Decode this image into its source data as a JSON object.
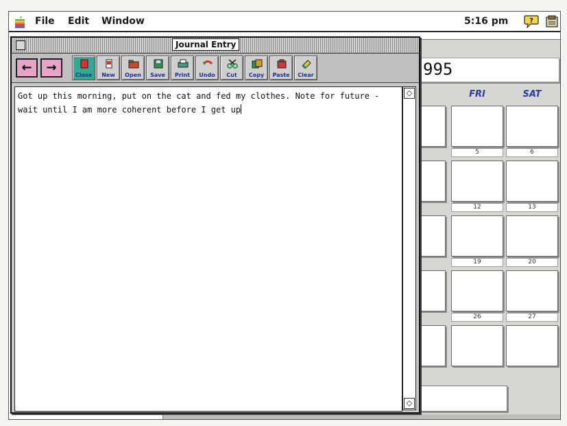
{
  "menubar": {
    "apple_icon": "apple-logo-icon",
    "items": [
      "File",
      "Edit",
      "Window"
    ],
    "clock": "5:16 pm",
    "help_icon": "balloon-help-icon",
    "app_icon": "application-menu-icon"
  },
  "journal_window": {
    "title": "Journal Entry",
    "nav": {
      "back": "←",
      "forward": "→"
    },
    "toolbar": [
      {
        "label": "Close",
        "icon": "close-book-icon",
        "color": "#e03030"
      },
      {
        "label": "New",
        "icon": "new-page-icon",
        "color": "#e03030"
      },
      {
        "label": "Open",
        "icon": "open-folder-icon",
        "color": "#c84a2a"
      },
      {
        "label": "Save",
        "icon": "save-disk-icon",
        "color": "#2f8f4f"
      },
      {
        "label": "Print",
        "icon": "printer-icon",
        "color": "#3f9a8a"
      },
      {
        "label": "Undo",
        "icon": "undo-icon",
        "color": "#c83a3a"
      },
      {
        "label": "Cut",
        "icon": "scissors-icon",
        "color": "#2f9a5a"
      },
      {
        "label": "Copy",
        "icon": "copy-icon",
        "color": "#d09a20"
      },
      {
        "label": "Paste",
        "icon": "paste-icon",
        "color": "#c83a3a"
      },
      {
        "label": "Clear",
        "icon": "eraser-icon",
        "color": "#e4c23a"
      }
    ],
    "body_text": "Got up this morning, put on the cat and fed my clothes. Note for future - wait until I am more coherent before I get up"
  },
  "calendar": {
    "year_fragment": "995",
    "day_names": [
      "FRI",
      "SAT"
    ],
    "day_numbers": [
      [
        "5",
        "6"
      ],
      [
        "12",
        "13"
      ],
      [
        "19",
        "20"
      ],
      [
        "26",
        "27"
      ]
    ],
    "header_accent": "#2a3aa8"
  }
}
